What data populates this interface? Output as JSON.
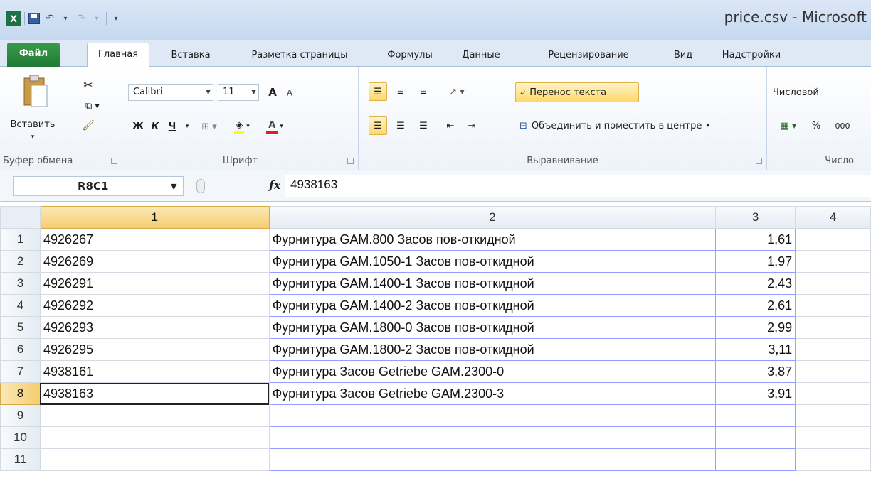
{
  "window": {
    "title": "price.csv - Microsoft"
  },
  "qat": {
    "app_icon": "excel-icon",
    "save_icon": "save-icon",
    "undo": "↶",
    "redo": "↷",
    "dropdown": "▾"
  },
  "tabs": [
    "Файл",
    "Главная",
    "Вставка",
    "Разметка страницы",
    "Формулы",
    "Данные",
    "Рецензирование",
    "Вид",
    "Надстройки"
  ],
  "ribbon": {
    "clipboard": {
      "label": "Буфер обмена",
      "paste": "Вставить"
    },
    "font": {
      "label": "Шрифт",
      "name": "Calibri",
      "size": "11",
      "bold": "Ж",
      "italic": "К",
      "underline": "Ч",
      "grow": "A",
      "shrink": "A"
    },
    "alignment": {
      "label": "Выравнивание",
      "wrap": "Перенос текста",
      "merge": "Объединить и поместить в центре"
    },
    "number": {
      "label": "Число",
      "format": "Числовой",
      "percent": "%",
      "thousands": "000"
    }
  },
  "formula_bar": {
    "name_box": "R8C1",
    "fx": "fx",
    "value": "4938163"
  },
  "sheet": {
    "columns": [
      "1",
      "2",
      "3",
      "4"
    ],
    "rows": [
      {
        "n": "1",
        "c1": "4926267",
        "c2": "Фурнитура GAM.800 Засов пов-откидной",
        "c3": "1,61"
      },
      {
        "n": "2",
        "c1": "4926269",
        "c2": "Фурнитура GAM.1050-1 Засов пов-откидной",
        "c3": "1,97"
      },
      {
        "n": "3",
        "c1": "4926291",
        "c2": "Фурнитура GAM.1400-1 Засов пов-откидной",
        "c3": "2,43"
      },
      {
        "n": "4",
        "c1": "4926292",
        "c2": "Фурнитура GAM.1400-2 Засов пов-откидной",
        "c3": "2,61"
      },
      {
        "n": "5",
        "c1": "4926293",
        "c2": "Фурнитура GAM.1800-0 Засов пов-откидной",
        "c3": "2,99"
      },
      {
        "n": "6",
        "c1": "4926295",
        "c2": "Фурнитура GAM.1800-2 Засов пов-откидной",
        "c3": "3,11"
      },
      {
        "n": "7",
        "c1": "4938161",
        "c2": "Фурнитура Засов Getriebe GAM.2300-0",
        "c3": "3,87"
      },
      {
        "n": "8",
        "c1": "4938163",
        "c2": "Фурнитура Засов Getriebe GAM.2300-3",
        "c3": "3,91"
      },
      {
        "n": "9",
        "c1": "",
        "c2": "",
        "c3": ""
      },
      {
        "n": "10",
        "c1": "",
        "c2": "",
        "c3": ""
      },
      {
        "n": "11",
        "c1": "",
        "c2": "",
        "c3": ""
      }
    ],
    "active_row": "8",
    "active_col": "1"
  },
  "colors": {
    "file_tab": "#1f7a34",
    "selection": "#f5cc6f",
    "border_blue": "#9b9cff"
  }
}
